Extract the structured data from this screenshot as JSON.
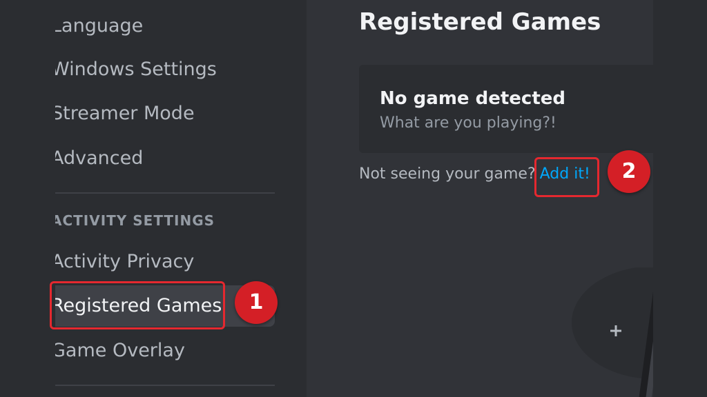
{
  "sidebar": {
    "items_top": [
      {
        "label": "Language"
      },
      {
        "label": "Windows Settings"
      },
      {
        "label": "Streamer Mode"
      },
      {
        "label": "Advanced"
      }
    ],
    "section_header": "ACTIVITY SETTINGS",
    "items_activity": [
      {
        "label": "Activity Privacy"
      },
      {
        "label": "Registered Games",
        "selected": true
      },
      {
        "label": "Game Overlay"
      }
    ]
  },
  "main": {
    "title": "Registered Games",
    "card": {
      "title": "No game detected",
      "subtitle": "What are you playing?!"
    },
    "add_prompt": "Not seeing your game?",
    "add_link": "Add it!"
  },
  "annotations": {
    "step1": "1",
    "step2": "2"
  },
  "colors": {
    "sidebar_bg": "#2b2d31",
    "main_bg": "#313338",
    "link": "#00a8fc",
    "highlight": "#e5282f"
  },
  "icons": [
    "controller-icon",
    "plus-icon"
  ]
}
